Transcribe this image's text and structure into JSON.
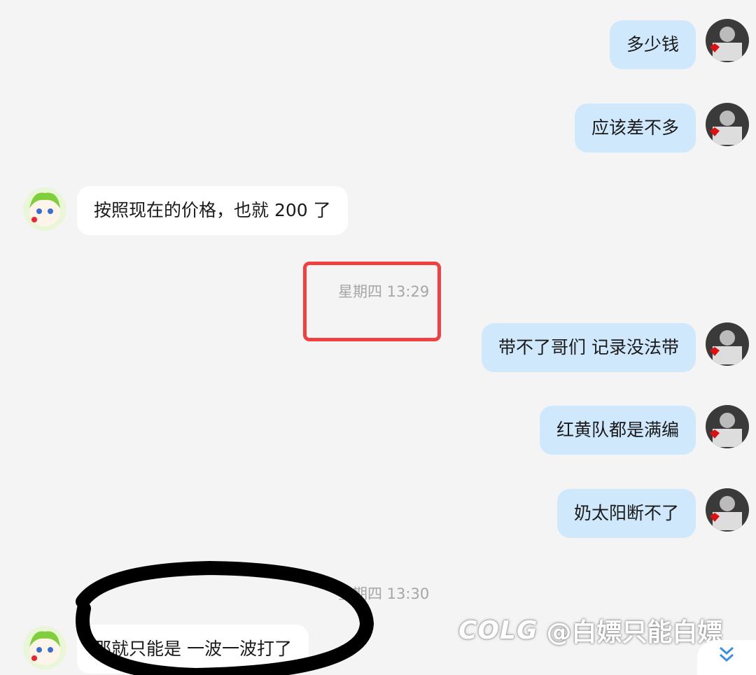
{
  "messages": [
    {
      "from": "me",
      "text": "多少钱"
    },
    {
      "from": "me",
      "text": "应该差不多"
    },
    {
      "from": "them",
      "text": "按照现在的价格，也就 200 了"
    },
    {
      "from": "me",
      "text": "带不了哥们 记录没法带"
    },
    {
      "from": "me",
      "text": "红黄队都是满编"
    },
    {
      "from": "me",
      "text": "奶太阳断不了"
    },
    {
      "from": "them",
      "text": "那就只能是 一波一波打了"
    }
  ],
  "timestamps": [
    "星期四 13:29",
    "星期四 13:30"
  ],
  "watermark": {
    "logo": "COLG",
    "handle": "@白嫖只能白嫖"
  },
  "colors": {
    "my_bubble": "#cfe8fb",
    "their_bubble": "#ffffff",
    "background": "#f4f4f4",
    "highlight_box": "#f24040",
    "scribble": "#000000"
  },
  "icons": {
    "scroll_down": "double-chevron-down-icon",
    "my_avatar": "user-avatar",
    "their_avatar": "green-haired-character-avatar"
  }
}
